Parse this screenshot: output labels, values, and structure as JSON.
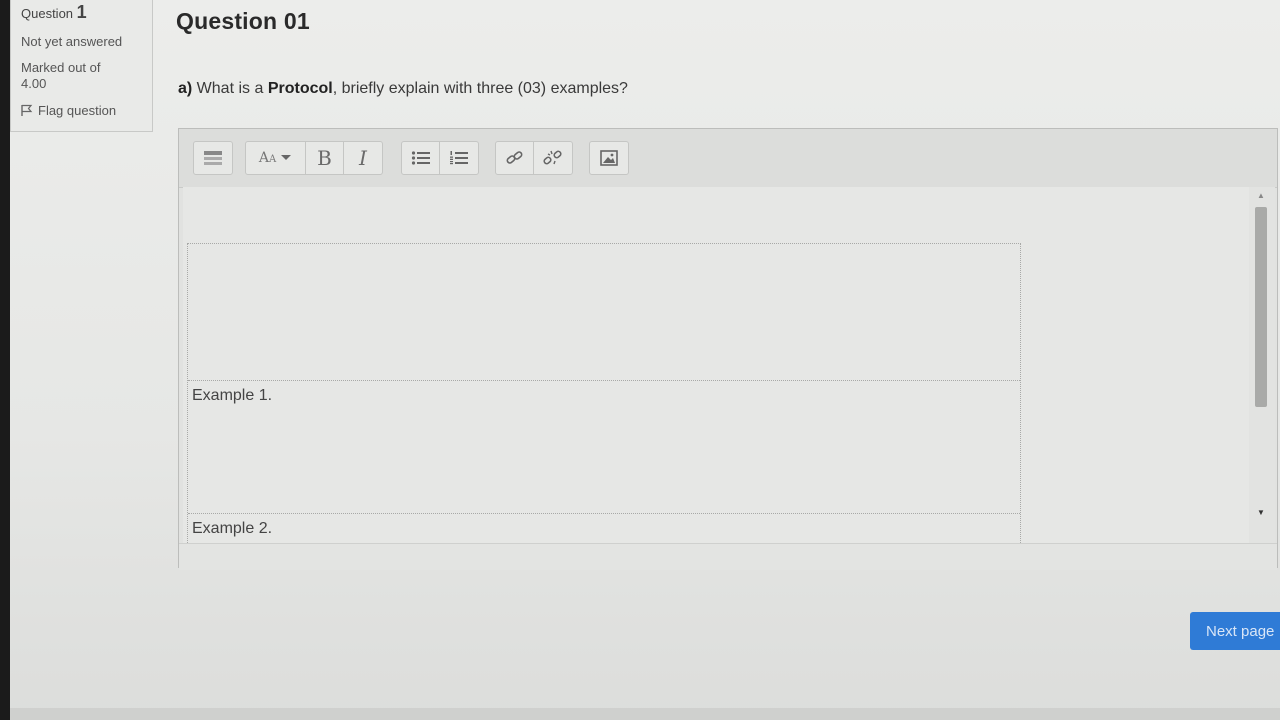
{
  "question_info": {
    "label": "Question",
    "number": "1",
    "state": "Not yet answered",
    "marked_line1": "Marked out of",
    "marked_line2": "4.00",
    "flag_label": "Flag question"
  },
  "main": {
    "title": "Question 01",
    "prompt_prefix": "a)",
    "prompt_before": " What is a ",
    "prompt_bold": "Protocol",
    "prompt_after": ", briefly explain with three (03) examples?"
  },
  "toolbar": {
    "bold_label": "B",
    "italic_label": "I",
    "font_label": "A"
  },
  "editor": {
    "table_rows": [
      "",
      "Example 1.",
      "Example 2."
    ]
  },
  "navigation": {
    "next_label": "Next page"
  },
  "colors": {
    "accent": "#2f7bd6"
  }
}
